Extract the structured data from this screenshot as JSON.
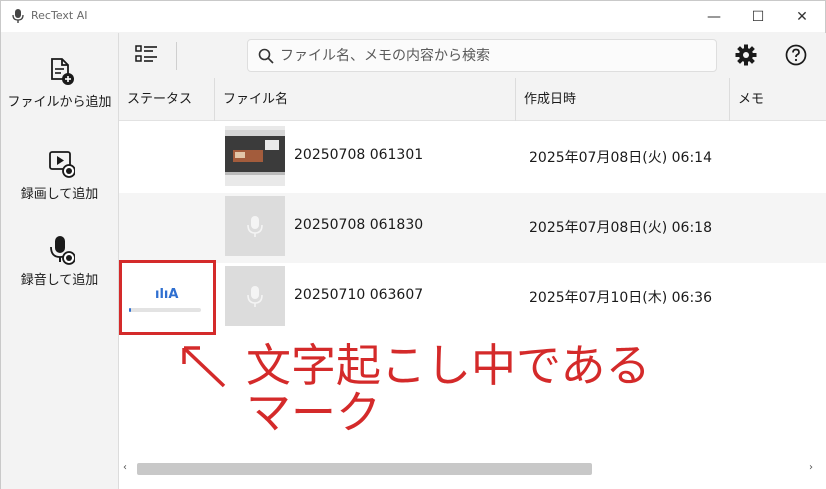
{
  "window": {
    "title": "RecText AI",
    "controls": {
      "minimize": "—",
      "maximize": "☐",
      "close": "✕"
    }
  },
  "sidebar": {
    "items": [
      {
        "label": "ファイルから追加",
        "icon": "file-add-icon"
      },
      {
        "label": "録画して追加",
        "icon": "video-record-icon"
      },
      {
        "label": "録音して追加",
        "icon": "mic-record-icon"
      }
    ]
  },
  "toolbar": {
    "list_toggle_icon": "list-view-icon",
    "search": {
      "placeholder": "ファイル名、メモの内容から検索",
      "value": ""
    },
    "settings_icon": "gear-icon",
    "help_icon": "help-icon"
  },
  "table": {
    "columns": [
      "ステータス",
      "ファイル名",
      "作成日時",
      "メモ"
    ],
    "rows": [
      {
        "status": "",
        "thumbnail": "video-thumbnail",
        "file_name": "20250708 061301",
        "created": "2025年07月08日(火) 06:14",
        "memo": ""
      },
      {
        "status": "",
        "thumbnail": "audio-thumbnail",
        "file_name": "20250708 061830",
        "created": "2025年07月08日(火) 06:18",
        "memo": ""
      },
      {
        "status": "transcribing",
        "status_label": "ılıA",
        "progress": 0.02,
        "thumbnail": "audio-thumbnail",
        "file_name": "20250710 063607",
        "created": "2025年07月10日(木) 06:36",
        "memo": ""
      }
    ]
  },
  "scrollbar": {
    "left_arrow": "‹",
    "right_arrow": "›"
  },
  "annotation": {
    "line1": "文字起こし中である",
    "line2": "マーク",
    "color": "#d42a2a"
  },
  "colors": {
    "accent": "#2f6fd0",
    "annotation": "#d42a2a"
  }
}
